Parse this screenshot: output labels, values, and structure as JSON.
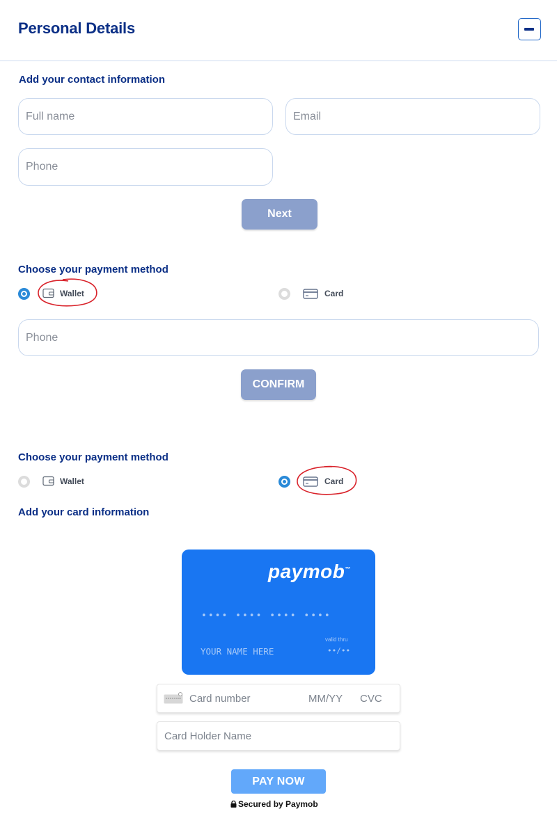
{
  "header": {
    "title": "Personal Details"
  },
  "contact": {
    "label": "Add your contact information",
    "full_name_placeholder": "Full name",
    "email_placeholder": "Email",
    "phone_placeholder": "Phone",
    "next_label": "Next"
  },
  "payment_wallet": {
    "label": "Choose your payment method",
    "wallet_label": "Wallet",
    "card_label": "Card",
    "selected": "Wallet",
    "phone_placeholder": "Phone",
    "confirm_label": "CONFIRM"
  },
  "payment_card": {
    "label": "Choose your payment method",
    "wallet_label": "Wallet",
    "card_label": "Card",
    "selected": "Card",
    "card_info_label": "Add your card information"
  },
  "card_preview": {
    "brand": "paymob",
    "tm": "™",
    "number_mask": "•••• •••• •••• ••••",
    "valid_thru": "valid thru",
    "name_placeholder": "YOUR NAME HERE",
    "expiry_mask": "••/••"
  },
  "card_form": {
    "number_placeholder": "Card number",
    "expiry_placeholder": "MM/YY",
    "cvc_placeholder": "CVC",
    "holder_placeholder": "Card Holder Name"
  },
  "pay_now_label": "PAY NOW",
  "secured_label": "Secured by Paymob",
  "colors": {
    "primary": "#0b2f86",
    "button_disabled": "#8ba0cc",
    "radio_active": "#2a8ad8",
    "card_blue": "#1976f2",
    "pay_button": "#62a8fa",
    "annotation_red": "#d9232b"
  }
}
